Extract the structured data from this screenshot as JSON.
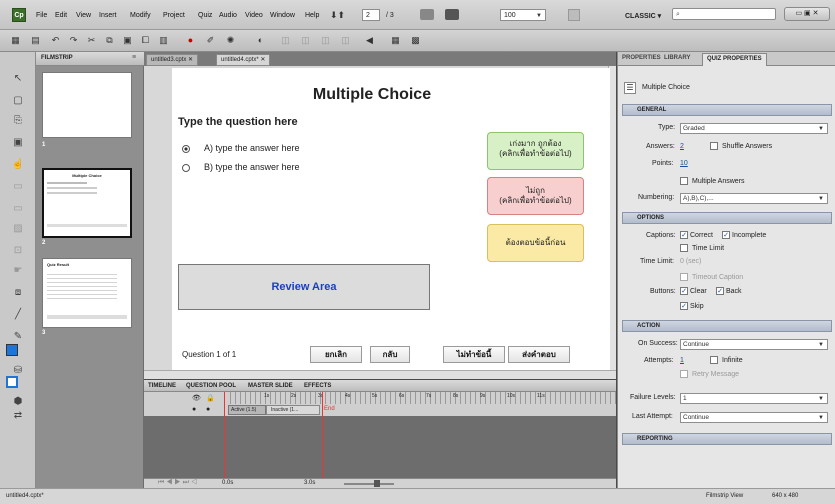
{
  "menubar": {
    "logo": "Cp",
    "items": [
      "File",
      "Edit",
      "View",
      "Insert",
      "Modify",
      "Project",
      "Quiz",
      "Audio",
      "Video",
      "Window",
      "Help"
    ],
    "page_current": "2",
    "page_total": "/ 3",
    "zoom": "100",
    "workspace": "CLASSIC",
    "search_placeholder": ""
  },
  "doc_tabs": [
    "untitled3.cptx",
    "untitled4.cptx*"
  ],
  "filmstrip": {
    "title": "FILMSTRIP",
    "slide_numbers": [
      "1",
      "2",
      "3"
    ],
    "thumb2_title": "Multiple Choice",
    "thumb3_title": "Quiz Result"
  },
  "slide": {
    "title": "Multiple Choice",
    "question": "Type the question here",
    "answer_a": "A) type the answer here",
    "answer_b": "B) type the answer here",
    "correct_caption": "เก่งมาก ถูกต้อง\n(คลิกเพื่อทำข้อต่อไป)",
    "incorrect_caption": "ไม่ถูก\n(คลิกเพื่อทำข้อต่อไป)",
    "incomplete_caption": "ต้องตอบข้อนี้ก่อน",
    "review_area": "Review Area",
    "progress": "Question 1 of 1",
    "buttons": {
      "clear": "ยกเลิก",
      "back": "กลับ",
      "skip": "ไม่ทำข้อนี้",
      "submit": "ส่งคำตอบ"
    }
  },
  "timeline": {
    "tabs": [
      "TIMELINE",
      "QUESTION POOL",
      "MASTER SLIDE",
      "EFFECTS"
    ],
    "ticks": [
      "1s",
      "2s",
      "3s",
      "4s",
      "5s",
      "6s",
      "7s",
      "8s",
      "9s",
      "10s",
      "11s"
    ],
    "track_label": "Active (1.5)",
    "track_inactive": "Inactive (1...",
    "end_label": "End",
    "time1": "0.0s",
    "time2": "3.0s"
  },
  "properties": {
    "tabs": [
      "PROPERTIES",
      "LIBRARY",
      "QUIZ PROPERTIES"
    ],
    "object_name": "Multiple Choice",
    "sections": {
      "general": "GENERAL",
      "options": "OPTIONS",
      "action": "ACTION",
      "reporting": "REPORTING"
    },
    "type_label": "Type:",
    "type_value": "Graded",
    "answers_label": "Answers:",
    "answers_value": "2",
    "shuffle": "Shuffle Answers",
    "points_label": "Points:",
    "points_value": "10",
    "multiple_answers": "Multiple Answers",
    "numbering_label": "Numbering:",
    "numbering_value": "A),B),C),...",
    "captions_label": "Captions:",
    "correct": "Correct",
    "incomplete": "Incomplete",
    "time_limit": "Time Limit",
    "time_limit_label": "Time Limit:",
    "time_limit_value": "0 (sec)",
    "timeout_caption": "Timeout Caption",
    "buttons_label": "Buttons:",
    "clear": "Clear",
    "back": "Back",
    "skip": "Skip",
    "on_success_label": "On Success:",
    "on_success_value": "Continue",
    "attempts_label": "Attempts:",
    "attempts_value": "1",
    "infinite": "Infinite",
    "retry_message": "Retry Message",
    "failure_levels_label": "Failure Levels:",
    "failure_levels_value": "1",
    "last_attempt_label": "Last Attempt:",
    "last_attempt_value": "Continue"
  },
  "statusbar": {
    "filename": "untitled4.cptx*",
    "view": "Filmstrip View",
    "size": "640 x 480"
  },
  "colors": {
    "correct_bg": "#d8f0c6",
    "incorrect_bg": "#f7cfcf",
    "incomplete_bg": "#fbeaa5",
    "review_text": "#1a3fc0",
    "accent_blue": "#1f74d6"
  }
}
